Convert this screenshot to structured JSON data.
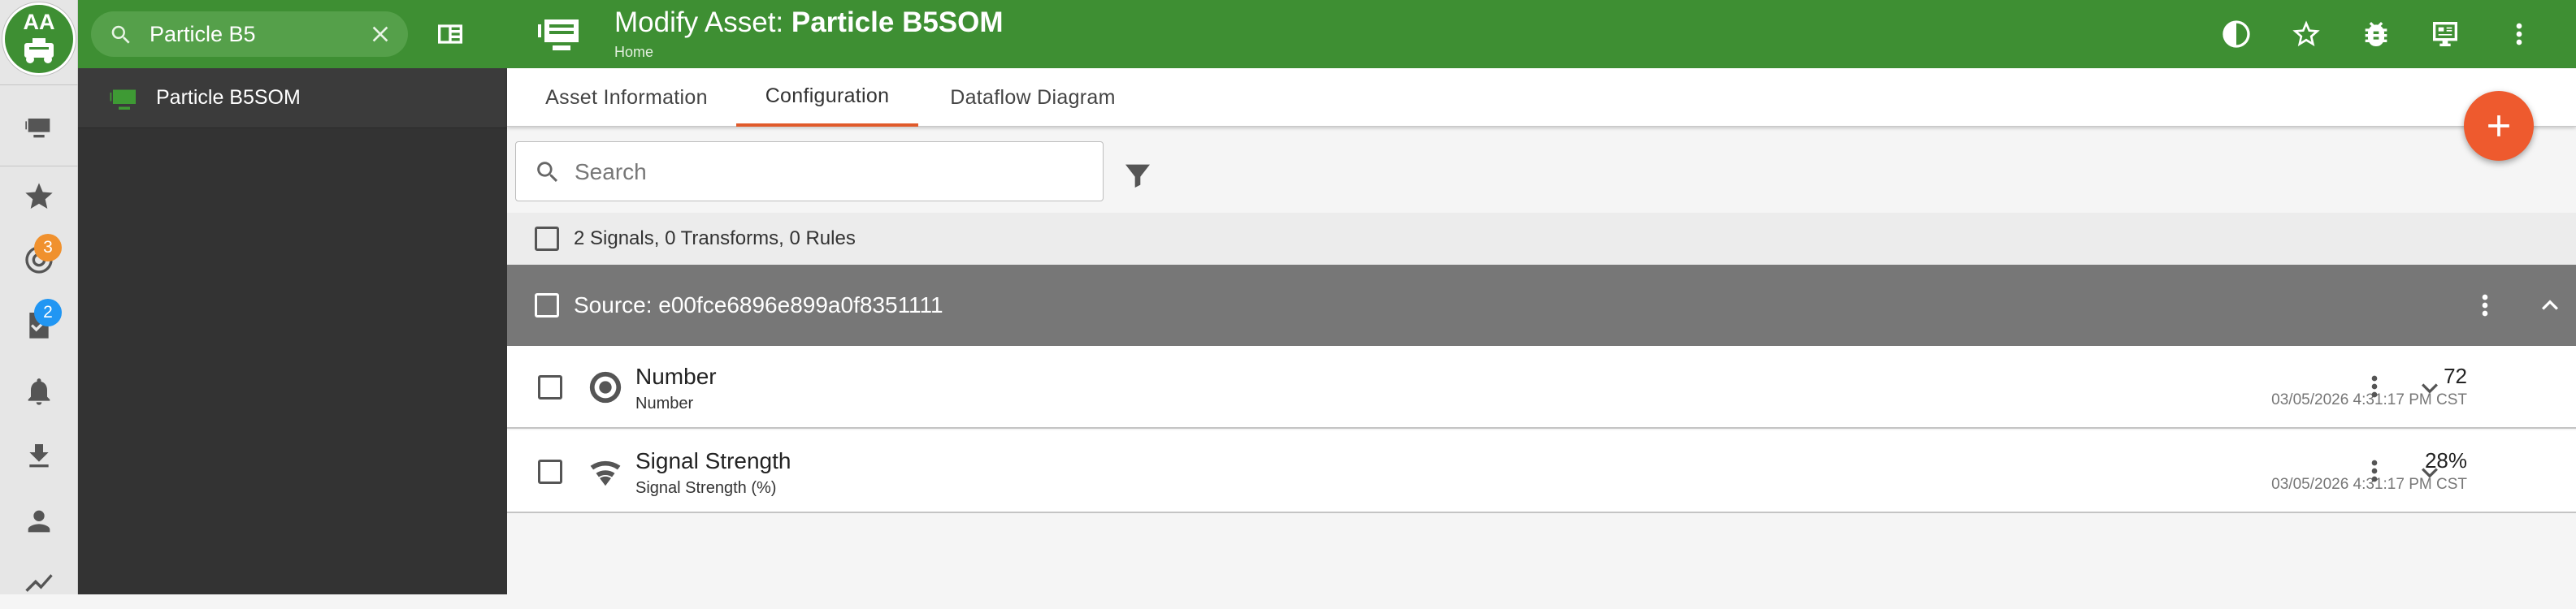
{
  "app": {
    "logo_text": "AA"
  },
  "rail": {
    "badges": {
      "monitor": "3",
      "tasks": "2"
    },
    "badge_colors": {
      "monitor": "#f0912e",
      "tasks": "#2196f3"
    }
  },
  "panel": {
    "search_value": "Particle B5",
    "results": [
      {
        "label": "Particle B5SOM"
      }
    ]
  },
  "header": {
    "title_prefix": "Modify Asset:",
    "title_asset": "Particle B5SOM",
    "breadcrumb": "Home"
  },
  "tabs": [
    {
      "label": "Asset Information"
    },
    {
      "label": "Configuration"
    },
    {
      "label": "Dataflow Diagram"
    }
  ],
  "active_tab": "Configuration",
  "search": {
    "placeholder": "Search"
  },
  "summary": {
    "text": "2 Signals, 0 Transforms, 0 Rules"
  },
  "source": {
    "label": "Source: e00fce6896e899a0f8351111"
  },
  "signals": [
    {
      "name": "Number",
      "subtitle": "Number",
      "value": "72",
      "timestamp": "03/05/2026 4:31:17 PM CST",
      "icon": "radio-button-icon"
    },
    {
      "name": "Signal Strength",
      "subtitle": "Signal Strength (%)",
      "value": "28%",
      "timestamp": "03/05/2026 4:31:17 PM CST",
      "icon": "wifi-icon"
    }
  ],
  "colors": {
    "brand_green": "#3e8f33",
    "accent_orange": "#ee5a2e",
    "source_header": "#777777"
  }
}
